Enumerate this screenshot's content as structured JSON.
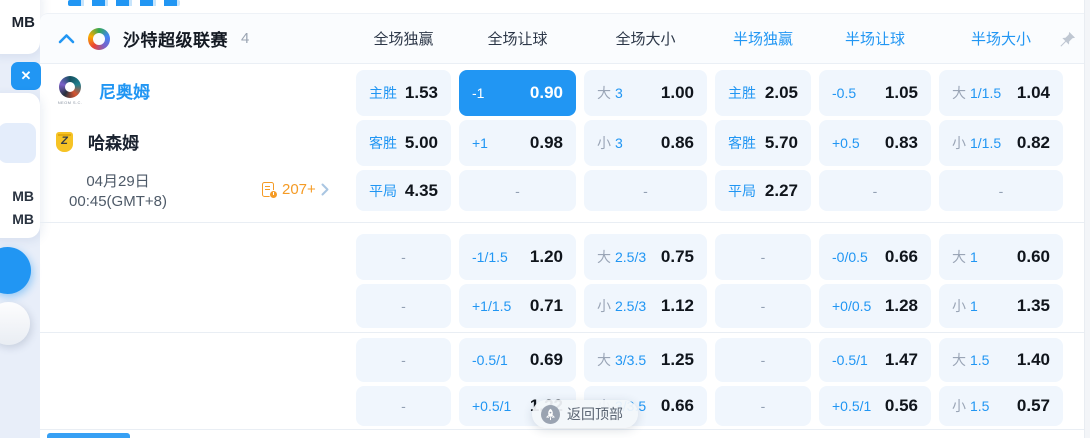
{
  "colors": {
    "accent": "#2196f3",
    "selected_bg": "#2196f3",
    "cell_bg": "#f0f6fd",
    "markets_orange": "#f59b25"
  },
  "left_strip": {
    "top_label": "MB",
    "close_label": "✕",
    "file_sizes": [
      "MB",
      "MB"
    ]
  },
  "league_header": {
    "title": "沙特超级联赛",
    "count": "4",
    "columns": [
      {
        "label": "全场独赢",
        "active": false
      },
      {
        "label": "全场让球",
        "active": false
      },
      {
        "label": "全场大小",
        "active": false
      },
      {
        "label": "半场独赢",
        "active": true
      },
      {
        "label": "半场让球",
        "active": true
      },
      {
        "label": "半场大小",
        "active": true
      }
    ]
  },
  "match": {
    "home_name": "尼奥姆",
    "home_logo_caption": "NEOM S.C.",
    "away_name": "哈森姆",
    "away_logo_glyph": "Z",
    "date_line1": "04月29日",
    "date_line2": "00:45(GMT+8)",
    "markets_count": "207+"
  },
  "odds_rows": [
    {
      "cells": [
        {
          "b": "主胜",
          "v": "1.53"
        },
        {
          "b": "-1",
          "v": "0.90",
          "sel": true
        },
        {
          "g": "大",
          "b": "3",
          "v": "1.00"
        },
        {
          "b": "主胜",
          "v": "2.05"
        },
        {
          "b": "-0.5",
          "v": "1.05"
        },
        {
          "g": "大",
          "b": "1/1.5",
          "v": "1.04"
        }
      ]
    },
    {
      "cells": [
        {
          "b": "客胜",
          "v": "5.00"
        },
        {
          "b": "+1",
          "v": "0.98"
        },
        {
          "g": "小",
          "b": "3",
          "v": "0.86"
        },
        {
          "b": "客胜",
          "v": "5.70"
        },
        {
          "b": "+0.5",
          "v": "0.83"
        },
        {
          "g": "小",
          "b": "1/1.5",
          "v": "0.82"
        }
      ]
    },
    {
      "cells": [
        {
          "b": "平局",
          "v": "4.35"
        },
        {
          "dash": true
        },
        {
          "dash": true
        },
        {
          "b": "平局",
          "v": "2.27"
        },
        {
          "dash": true
        },
        {
          "dash": true
        }
      ]
    },
    {
      "cells": [
        {
          "dash": true
        },
        {
          "b": "-1/1.5",
          "v": "1.20"
        },
        {
          "g": "大",
          "b": "2.5/3",
          "v": "0.75"
        },
        {
          "dash": true
        },
        {
          "b": "-0/0.5",
          "v": "0.66"
        },
        {
          "g": "大",
          "b": "1",
          "v": "0.60"
        }
      ]
    },
    {
      "cells": [
        {
          "dash": true
        },
        {
          "b": "+1/1.5",
          "v": "0.71"
        },
        {
          "g": "小",
          "b": "2.5/3",
          "v": "1.12"
        },
        {
          "dash": true
        },
        {
          "b": "+0/0.5",
          "v": "1.28"
        },
        {
          "g": "小",
          "b": "1",
          "v": "1.35"
        }
      ]
    },
    {
      "cells": [
        {
          "dash": true
        },
        {
          "b": "-0.5/1",
          "v": "0.69"
        },
        {
          "g": "大",
          "b": "3/3.5",
          "v": "1.25"
        },
        {
          "dash": true
        },
        {
          "b": "-0.5/1",
          "v": "1.47"
        },
        {
          "g": "大",
          "b": "1.5",
          "v": "1.40"
        }
      ]
    },
    {
      "cells": [
        {
          "dash": true
        },
        {
          "b": "+0.5/1",
          "v": "1.22"
        },
        {
          "g": "小",
          "b": "3/3.5",
          "v": "0.66"
        },
        {
          "dash": true
        },
        {
          "b": "+0.5/1",
          "v": "0.56"
        },
        {
          "g": "小",
          "b": "1.5",
          "v": "0.57"
        }
      ]
    }
  ],
  "back_to_top": {
    "label": "返回顶部"
  }
}
